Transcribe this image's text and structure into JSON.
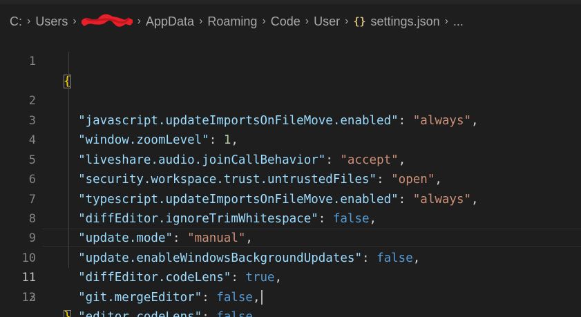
{
  "breadcrumb": {
    "drive": "C:",
    "users": "Users",
    "username_redacted": "wwwwDuk",
    "appdata": "AppData",
    "roaming": "Roaming",
    "code": "Code",
    "user": "User",
    "file_icon": "braces-icon",
    "file": "settings.json",
    "more": "..."
  },
  "editor": {
    "current_line": 11,
    "lines": [
      {
        "num": "1",
        "open_brace": "{"
      },
      {
        "num": "2",
        "key": "\"javascript.updateImportsOnFileMove.enabled\"",
        "value": "\"always\"",
        "comma": ","
      },
      {
        "num": "3",
        "key": "\"window.zoomLevel\"",
        "value": "1",
        "comma": ","
      },
      {
        "num": "4",
        "key": "\"liveshare.audio.joinCallBehavior\"",
        "value": "\"accept\"",
        "comma": ","
      },
      {
        "num": "5",
        "key": "\"security.workspace.trust.untrustedFiles\"",
        "value": "\"open\"",
        "comma": ","
      },
      {
        "num": "6",
        "key": "\"typescript.updateImportsOnFileMove.enabled\"",
        "value": "\"always\"",
        "comma": ","
      },
      {
        "num": "7",
        "key": "\"diffEditor.ignoreTrimWhitespace\"",
        "value": "false",
        "comma": ","
      },
      {
        "num": "8",
        "key": "\"update.mode\"",
        "value": "\"manual\"",
        "comma": ","
      },
      {
        "num": "9",
        "key": "\"update.enableWindowsBackgroundUpdates\"",
        "value": "false",
        "comma": ","
      },
      {
        "num": "10",
        "key": "\"diffEditor.codeLens\"",
        "value": "true",
        "comma": ","
      },
      {
        "num": "11",
        "key": "\"git.mergeEditor\"",
        "value": "false",
        "comma": ","
      },
      {
        "num": "12",
        "key": "\"editor.codeLens\"",
        "value": "false",
        "comma": ""
      },
      {
        "num": "13",
        "close_brace": "}"
      }
    ]
  },
  "colors": {
    "background": "#1e1e1e",
    "json_key": "#9cdcfe",
    "json_string": "#ce9178",
    "json_number": "#b5cea8",
    "json_boolean": "#569cd6",
    "bracket": "#ffd700",
    "line_number": "#858585",
    "redaction": "#e8202a"
  }
}
